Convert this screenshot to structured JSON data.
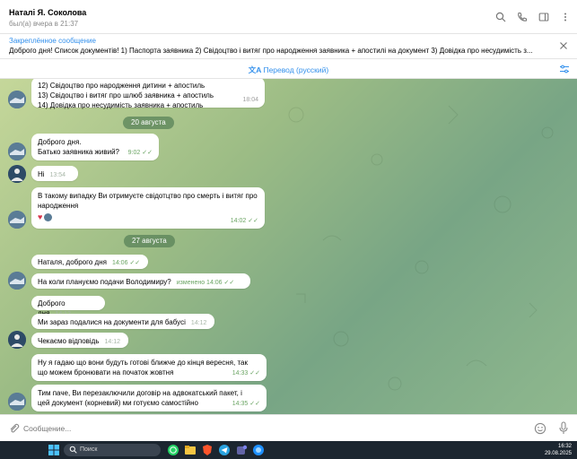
{
  "header": {
    "name": "Наталі Я. Соколова",
    "status": "был(а) вчера в 21:37",
    "icons": [
      "search-icon",
      "phone-icon",
      "sidebar-icon",
      "more-icon"
    ]
  },
  "pinned": {
    "title": "Закреплённое сообщение",
    "text": "Доброго дня! Список документів!  1) Паспорта заявника 2) Свідоцтво і витяг про народження заявника + апостилі на документ 3) Довідка про несудимість з..."
  },
  "translate": {
    "label": "Перевод (русский)"
  },
  "messages": {
    "m1": {
      "lines": "12) Свідоцтво про народження дитини + апостиль\n13) Свідоцтво і витяг про шлюб заявника + апостиль\n14) Довідка про несудимість заявника + апостиль",
      "time": "18:04"
    },
    "date1": "20 августа",
    "m2": {
      "text": "Доброго дня.\nБатько заявника живий?",
      "time": "9:02"
    },
    "m3": {
      "text": "Ні",
      "time": "13:54"
    },
    "m4": {
      "text": "В такому випадку Ви отримуєте свідотцтво про смерть і витяг про\nнародження",
      "emoji": "♥",
      "time": "14:02"
    },
    "date2": "27 августа",
    "m5": {
      "text": "Наталя, доброго дня",
      "time": "14:06"
    },
    "m6": {
      "text": "На коли плануємо подачи Володимиру?",
      "time": "изменено 14:06"
    },
    "m7": {
      "text": "Доброго дня",
      "time": "14:12"
    },
    "m8": {
      "text": "Ми зараз подалися на документи для бабусі",
      "time": "14:12"
    },
    "m9": {
      "text": "Чекаємо відповідь",
      "time": "14:12"
    },
    "m10": {
      "text": "Ну я гадаю що вони будуть готові ближче до кінця вересня, так\nщо можем бронювати на початок жовтня",
      "time": "14:33"
    },
    "m11": {
      "text": "Тим паче, Ви перезаключили договір на адвокатський пакет, і\nцей документ (корневий) ми готуємо самостійно",
      "time": "14:35"
    }
  },
  "composer": {
    "placeholder": "Сообщение..."
  },
  "taskbar": {
    "search_label": "Поиск",
    "time": "16:32",
    "date": "29.08.2025"
  },
  "colors": {
    "accent": "#3390ec",
    "check": "#6aa463"
  }
}
